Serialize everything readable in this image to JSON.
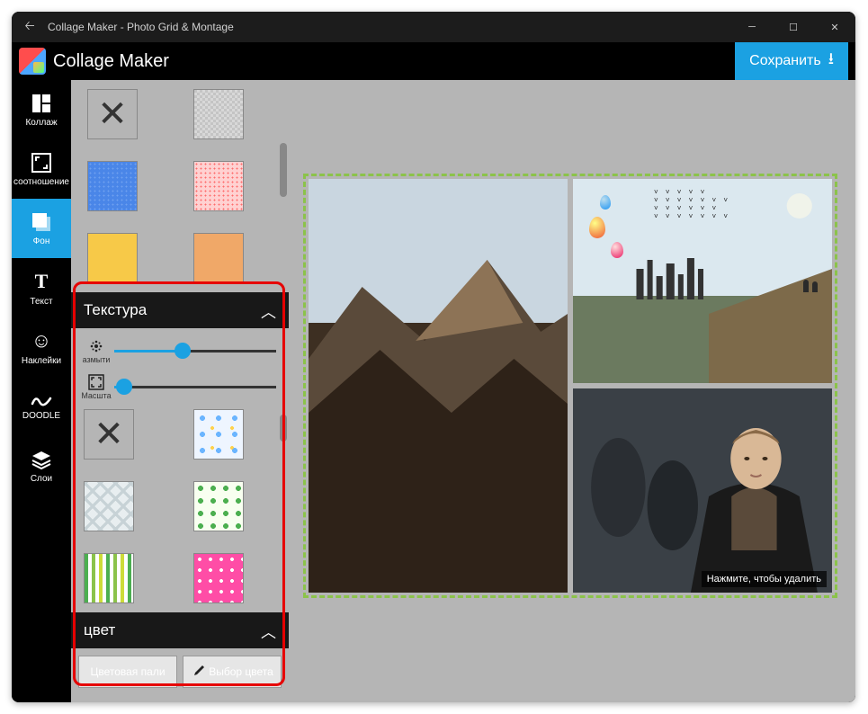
{
  "window": {
    "title": "Collage Maker - Photo Grid & Montage"
  },
  "appbar": {
    "name": "Collage Maker",
    "save": "Сохранить"
  },
  "toolbar": {
    "items": [
      {
        "id": "collage",
        "label": "Коллаж"
      },
      {
        "id": "ratio",
        "label": "соотношение"
      },
      {
        "id": "bg",
        "label": "Фон",
        "active": true
      },
      {
        "id": "text",
        "label": "Текст"
      },
      {
        "id": "sticker",
        "label": "Наклейки"
      },
      {
        "id": "doodle",
        "label": "DOODLE"
      },
      {
        "id": "layers",
        "label": "Слои"
      }
    ]
  },
  "panel": {
    "top_swatches": [
      {
        "id": "none",
        "type": "none"
      },
      {
        "id": "grey-dots",
        "color1": "#d8d8d8",
        "color2": "#c4c4c4"
      },
      {
        "id": "blue",
        "color": "#4a86e8"
      },
      {
        "id": "pink-dots",
        "color1": "#ffd1d1",
        "color2": "#ff6b6b"
      },
      {
        "id": "yellow",
        "color": "#f7c948"
      },
      {
        "id": "orange",
        "color": "#f0a868"
      }
    ],
    "texture": {
      "title": "Текстура",
      "blur": {
        "label": "азмыти",
        "value": 42
      },
      "scale": {
        "label": "Масшта",
        "value": 6
      },
      "swatches": [
        {
          "id": "none",
          "type": "none"
        },
        {
          "id": "bubbles",
          "bg": "#eef5ff"
        },
        {
          "id": "chevron",
          "bg": "#e8eef0"
        },
        {
          "id": "clover",
          "bg": "#f0f8e8"
        },
        {
          "id": "stripes",
          "bg": "#fff"
        },
        {
          "id": "pinkdot",
          "bg": "#ff4da6"
        }
      ]
    },
    "color": {
      "title": "цвет",
      "palette": "Цветовая пали",
      "picker": "Выбор цвета"
    }
  },
  "canvas": {
    "delete_hint": "Нажмите, чтобы удалить"
  }
}
